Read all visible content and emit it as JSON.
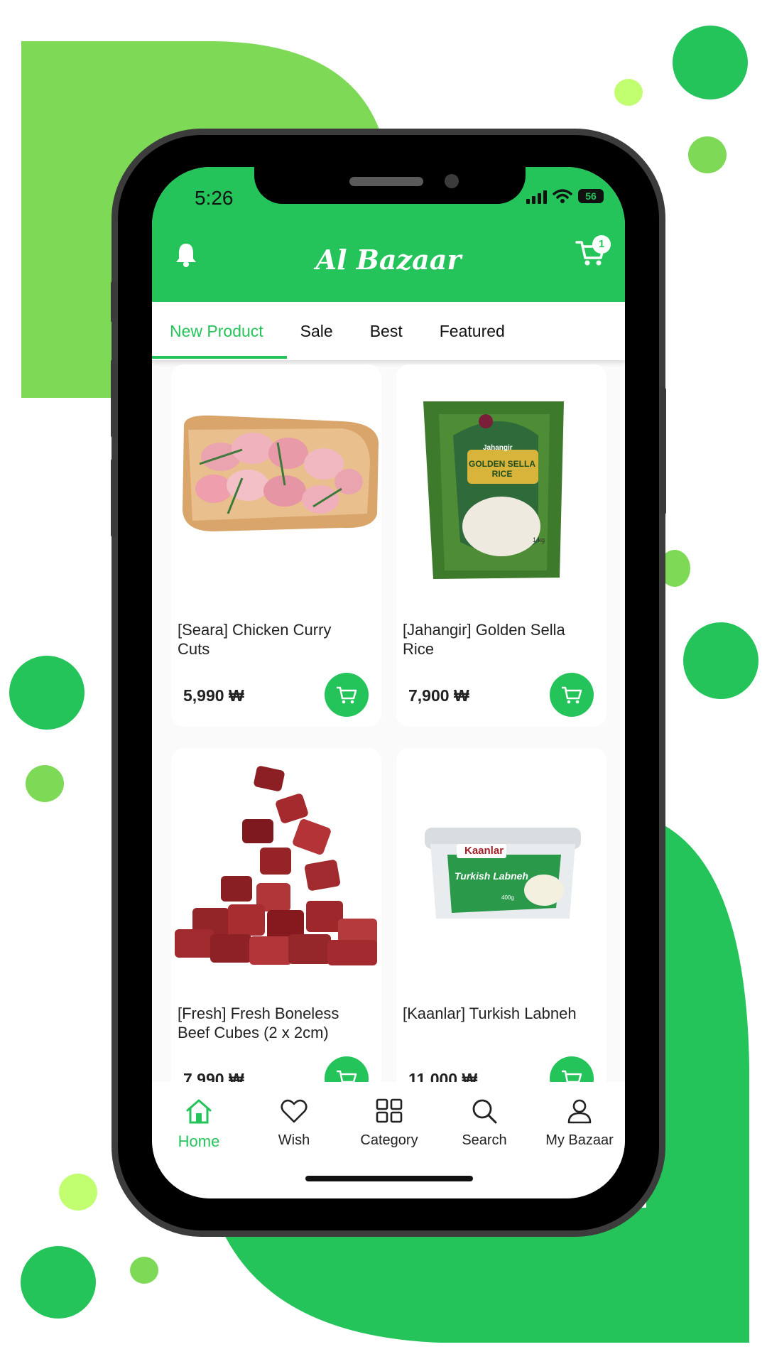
{
  "status_bar": {
    "time": "5:26",
    "battery": "56"
  },
  "header": {
    "brand": "Al Bazaar",
    "cart_count": "1"
  },
  "tabs": [
    {
      "label": "New Product",
      "active": true
    },
    {
      "label": "Sale"
    },
    {
      "label": "Best"
    },
    {
      "label": "Featured"
    }
  ],
  "products": [
    {
      "name": "[Seara] Chicken Curry Cuts",
      "price": "5,990 ₩"
    },
    {
      "name": "[Jahangir] Golden Sella Rice",
      "price": "7,900 ₩"
    },
    {
      "name": "[Fresh] Fresh Boneless Beef Cubes (2 x 2cm)",
      "price": "7,990 ₩"
    },
    {
      "name": "[Kaanlar] Turkish Labneh",
      "price": "11,000 ₩"
    }
  ],
  "product_images": {
    "rice_brand": "Jahangir",
    "rice_text": "GOLDEN SELLA RICE",
    "rice_weight": "1 kg",
    "labneh_brand": "Kaanlar",
    "labneh_text": "Turkish Labneh",
    "labneh_weight": "400g"
  },
  "bottom_nav": [
    {
      "label": "Home",
      "icon": "home-icon",
      "active": true
    },
    {
      "label": "Wish",
      "icon": "heart-icon"
    },
    {
      "label": "Category",
      "icon": "grid-icon"
    },
    {
      "label": "Search",
      "icon": "search-icon"
    },
    {
      "label": "My Bazaar",
      "icon": "user-icon"
    }
  ],
  "colors": {
    "brand_green": "#25c45b",
    "light_green": "#7ed957",
    "lime": "#c2ff70"
  }
}
